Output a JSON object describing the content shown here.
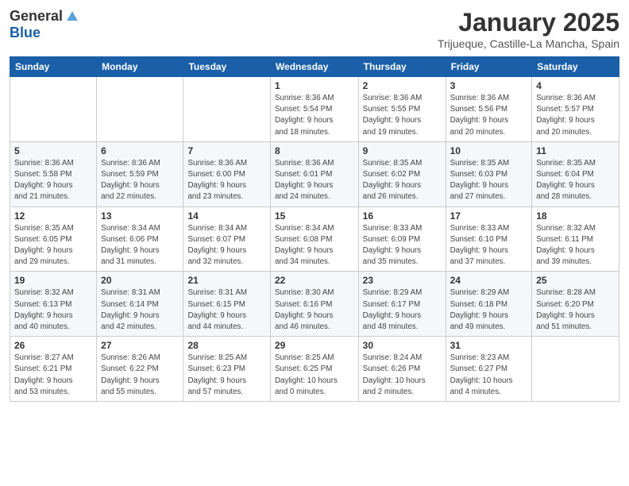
{
  "header": {
    "logo_general": "General",
    "logo_blue": "Blue",
    "month_title": "January 2025",
    "location": "Trijueque, Castille-La Mancha, Spain"
  },
  "days_of_week": [
    "Sunday",
    "Monday",
    "Tuesday",
    "Wednesday",
    "Thursday",
    "Friday",
    "Saturday"
  ],
  "weeks": [
    [
      {
        "day": "",
        "info": ""
      },
      {
        "day": "",
        "info": ""
      },
      {
        "day": "",
        "info": ""
      },
      {
        "day": "1",
        "info": "Sunrise: 8:36 AM\nSunset: 5:54 PM\nDaylight: 9 hours\nand 18 minutes."
      },
      {
        "day": "2",
        "info": "Sunrise: 8:36 AM\nSunset: 5:55 PM\nDaylight: 9 hours\nand 19 minutes."
      },
      {
        "day": "3",
        "info": "Sunrise: 8:36 AM\nSunset: 5:56 PM\nDaylight: 9 hours\nand 20 minutes."
      },
      {
        "day": "4",
        "info": "Sunrise: 8:36 AM\nSunset: 5:57 PM\nDaylight: 9 hours\nand 20 minutes."
      }
    ],
    [
      {
        "day": "5",
        "info": "Sunrise: 8:36 AM\nSunset: 5:58 PM\nDaylight: 9 hours\nand 21 minutes."
      },
      {
        "day": "6",
        "info": "Sunrise: 8:36 AM\nSunset: 5:59 PM\nDaylight: 9 hours\nand 22 minutes."
      },
      {
        "day": "7",
        "info": "Sunrise: 8:36 AM\nSunset: 6:00 PM\nDaylight: 9 hours\nand 23 minutes."
      },
      {
        "day": "8",
        "info": "Sunrise: 8:36 AM\nSunset: 6:01 PM\nDaylight: 9 hours\nand 24 minutes."
      },
      {
        "day": "9",
        "info": "Sunrise: 8:35 AM\nSunset: 6:02 PM\nDaylight: 9 hours\nand 26 minutes."
      },
      {
        "day": "10",
        "info": "Sunrise: 8:35 AM\nSunset: 6:03 PM\nDaylight: 9 hours\nand 27 minutes."
      },
      {
        "day": "11",
        "info": "Sunrise: 8:35 AM\nSunset: 6:04 PM\nDaylight: 9 hours\nand 28 minutes."
      }
    ],
    [
      {
        "day": "12",
        "info": "Sunrise: 8:35 AM\nSunset: 6:05 PM\nDaylight: 9 hours\nand 29 minutes."
      },
      {
        "day": "13",
        "info": "Sunrise: 8:34 AM\nSunset: 6:06 PM\nDaylight: 9 hours\nand 31 minutes."
      },
      {
        "day": "14",
        "info": "Sunrise: 8:34 AM\nSunset: 6:07 PM\nDaylight: 9 hours\nand 32 minutes."
      },
      {
        "day": "15",
        "info": "Sunrise: 8:34 AM\nSunset: 6:08 PM\nDaylight: 9 hours\nand 34 minutes."
      },
      {
        "day": "16",
        "info": "Sunrise: 8:33 AM\nSunset: 6:09 PM\nDaylight: 9 hours\nand 35 minutes."
      },
      {
        "day": "17",
        "info": "Sunrise: 8:33 AM\nSunset: 6:10 PM\nDaylight: 9 hours\nand 37 minutes."
      },
      {
        "day": "18",
        "info": "Sunrise: 8:32 AM\nSunset: 6:11 PM\nDaylight: 9 hours\nand 39 minutes."
      }
    ],
    [
      {
        "day": "19",
        "info": "Sunrise: 8:32 AM\nSunset: 6:13 PM\nDaylight: 9 hours\nand 40 minutes."
      },
      {
        "day": "20",
        "info": "Sunrise: 8:31 AM\nSunset: 6:14 PM\nDaylight: 9 hours\nand 42 minutes."
      },
      {
        "day": "21",
        "info": "Sunrise: 8:31 AM\nSunset: 6:15 PM\nDaylight: 9 hours\nand 44 minutes."
      },
      {
        "day": "22",
        "info": "Sunrise: 8:30 AM\nSunset: 6:16 PM\nDaylight: 9 hours\nand 46 minutes."
      },
      {
        "day": "23",
        "info": "Sunrise: 8:29 AM\nSunset: 6:17 PM\nDaylight: 9 hours\nand 48 minutes."
      },
      {
        "day": "24",
        "info": "Sunrise: 8:29 AM\nSunset: 6:18 PM\nDaylight: 9 hours\nand 49 minutes."
      },
      {
        "day": "25",
        "info": "Sunrise: 8:28 AM\nSunset: 6:20 PM\nDaylight: 9 hours\nand 51 minutes."
      }
    ],
    [
      {
        "day": "26",
        "info": "Sunrise: 8:27 AM\nSunset: 6:21 PM\nDaylight: 9 hours\nand 53 minutes."
      },
      {
        "day": "27",
        "info": "Sunrise: 8:26 AM\nSunset: 6:22 PM\nDaylight: 9 hours\nand 55 minutes."
      },
      {
        "day": "28",
        "info": "Sunrise: 8:25 AM\nSunset: 6:23 PM\nDaylight: 9 hours\nand 57 minutes."
      },
      {
        "day": "29",
        "info": "Sunrise: 8:25 AM\nSunset: 6:25 PM\nDaylight: 10 hours\nand 0 minutes."
      },
      {
        "day": "30",
        "info": "Sunrise: 8:24 AM\nSunset: 6:26 PM\nDaylight: 10 hours\nand 2 minutes."
      },
      {
        "day": "31",
        "info": "Sunrise: 8:23 AM\nSunset: 6:27 PM\nDaylight: 10 hours\nand 4 minutes."
      },
      {
        "day": "",
        "info": ""
      }
    ]
  ]
}
